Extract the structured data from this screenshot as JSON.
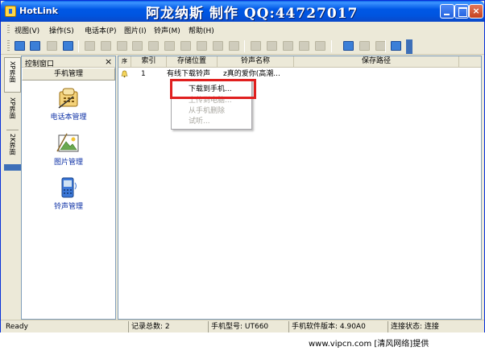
{
  "window": {
    "app_title": "HotLink",
    "banner": "阿龙纳斯  制作  QQ:44727017"
  },
  "menubar": {
    "items": [
      "视图(V)",
      "操作(S)",
      "电话本(P)",
      "图片(I)",
      "铃声(M)",
      "帮助(H)"
    ]
  },
  "left_tabs": [
    "XP界面",
    "XP界面",
    "2K界面"
  ],
  "control_panel": {
    "title": "控制窗口",
    "close_glyph": "×",
    "section": "手机管理",
    "items": [
      {
        "label": "电话本管理",
        "icon": "phonebook-icon"
      },
      {
        "label": "图片管理",
        "icon": "picture-icon"
      },
      {
        "label": "铃声管理",
        "icon": "ringtone-icon"
      }
    ]
  },
  "list": {
    "columns": [
      "序号",
      "索引",
      "存储位置",
      "铃声名称",
      "保存路径"
    ],
    "first_column_header": "序",
    "rows": [
      {
        "icon": "bell-icon",
        "index": "1",
        "location": "有线下载铃声",
        "name": "z真的爱你(高潮...",
        "path": ""
      }
    ]
  },
  "context_menu": {
    "items": [
      {
        "label": "下载到手机...",
        "enabled": true
      },
      {
        "label": "上传到电脑...",
        "enabled": false
      },
      {
        "label": "从手机删除",
        "enabled": false
      },
      {
        "label": "试听...",
        "enabled": false
      }
    ],
    "highlight_color": "#e0201f"
  },
  "statusbar": {
    "ready": "Ready",
    "record_count": "记录总数: 2",
    "phone_model": "手机型号: UT660",
    "software_version": "手机软件版本: 4.90A0",
    "connection": "连接状态: 连接"
  },
  "footer": {
    "text": "www.vipcn.com [清风网络]提供"
  }
}
